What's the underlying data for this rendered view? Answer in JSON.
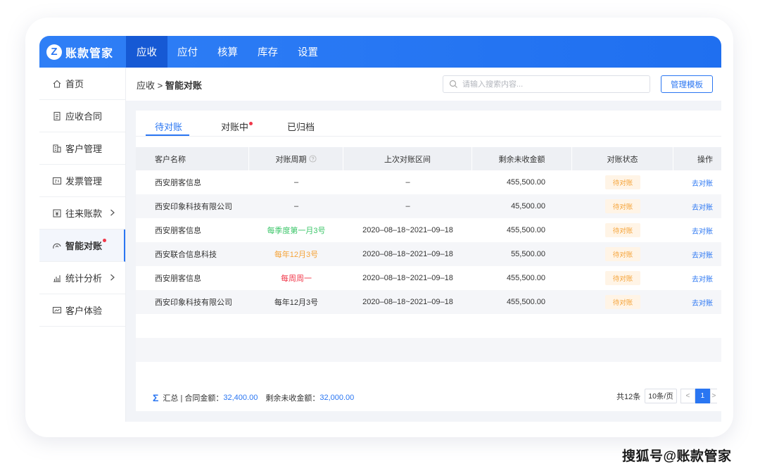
{
  "app": {
    "logo_mark": "Z",
    "title": "账款管家"
  },
  "nav": [
    {
      "label": "应收",
      "active": true
    },
    {
      "label": "应付"
    },
    {
      "label": "核算"
    },
    {
      "label": "库存"
    },
    {
      "label": "设置"
    }
  ],
  "sidebar": {
    "items": [
      {
        "label": "首页",
        "icon": "home-icon"
      },
      {
        "label": "应收合同",
        "icon": "document-icon"
      },
      {
        "label": "客户管理",
        "icon": "building-icon"
      },
      {
        "label": "发票管理",
        "icon": "invoice-icon"
      },
      {
        "label": "往来账款",
        "icon": "money-icon"
      },
      {
        "label": "智能对账",
        "icon": "reconcile-icon"
      },
      {
        "label": "统计分析",
        "icon": "chart-icon"
      },
      {
        "label": "客户体验",
        "icon": "monitor-icon"
      }
    ]
  },
  "header": {
    "breadcrumb_parent": "应收",
    "breadcrumb_sep": ">",
    "breadcrumb_current": "智能对账",
    "search_placeholder": "请输入搜索内容...",
    "manage_template_label": "管理模板"
  },
  "tabs": [
    {
      "label": "待对账",
      "active": true
    },
    {
      "label": "对账中",
      "dot": true
    },
    {
      "label": "已归档"
    }
  ],
  "table": {
    "columns": [
      "客户名称",
      "对账周期",
      "上次对账区间",
      "剩余未收金额",
      "对账状态",
      "操作"
    ],
    "rows": [
      {
        "customer": "西安朋客信息",
        "cycle": "–",
        "cycle_color": "#333333",
        "interval": "–",
        "remaining": "455,500.00",
        "status": "待对账",
        "action": "去对账"
      },
      {
        "customer": "西安印象科技有限公司",
        "cycle": "–",
        "cycle_color": "#333333",
        "interval": "–",
        "remaining": "45,500.00",
        "status": "待对账",
        "action": "去对账"
      },
      {
        "customer": "西安朋客信息",
        "cycle": "每季度第一月3号",
        "cycle_color": "#3cc66a",
        "interval": "2020–08–18~2021–09–18",
        "remaining": "455,500.00",
        "status": "待对账",
        "action": "去对账"
      },
      {
        "customer": "西安联合信息科技",
        "cycle": "每年12月3号",
        "cycle_color": "#f5a43a",
        "interval": "2020–08–18~2021–09–18",
        "remaining": "55,500.00",
        "status": "待对账",
        "action": "去对账"
      },
      {
        "customer": "西安朋客信息",
        "cycle": "每周周一",
        "cycle_color": "#f0384a",
        "interval": "2020–08–18~2021–09–18",
        "remaining": "455,500.00",
        "status": "待对账",
        "action": "去对账"
      },
      {
        "customer": "西安印象科技有限公司",
        "cycle": "每年12月3号",
        "cycle_color": "#333333",
        "interval": "2020–08–18~2021–09–18",
        "remaining": "455,500.00",
        "status": "待对账",
        "action": "去对账"
      }
    ]
  },
  "summary": {
    "sigma": "Σ",
    "label": "汇总 | 合同金额：",
    "contract_amount": "32,400.00",
    "remaining_label": "剩余未收金额：",
    "remaining_amount": "32,000.00"
  },
  "pager": {
    "total": "共12条",
    "page_size": "10条/页",
    "prev": "<",
    "current": "1",
    "next": ">"
  },
  "watermark": "搜狐号@账款管家",
  "colors": {
    "primary": "#2a76f2",
    "nav_active": "#1659d4",
    "badge_bg": "#fff4e6",
    "badge_text": "#f5a43a",
    "dot": "#f0384a"
  }
}
